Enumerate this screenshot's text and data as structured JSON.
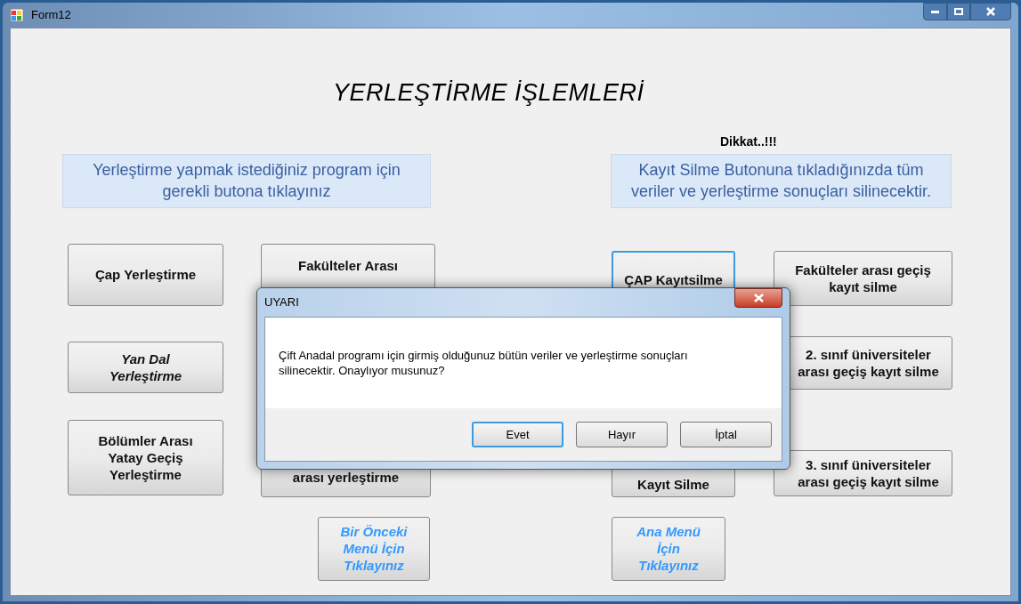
{
  "window": {
    "title": "Form12"
  },
  "heading": "YERLEŞTİRME İŞLEMLERİ",
  "left_note": "Yerleştirme yapmak istediğiniz program için gerekli butona tıklayınız",
  "warning_label": "Dikkat..!!!",
  "right_note": "Kayıt Silme Butonuna tıkladığınızda tüm veriler ve yerleştirme sonuçları silinecektir.",
  "columns": [
    {
      "buttons": [
        {
          "label": "Çap Yerleştirme",
          "kind": "bold",
          "focused": false
        },
        {
          "label": "Yan Dal\nYerleştirme",
          "kind": "italic",
          "focused": false
        },
        {
          "label": "Bölümler Arası\nYatay Geçiş\nYerleştirme",
          "kind": "bold",
          "focused": false
        }
      ]
    },
    {
      "buttons": [
        {
          "label": "Fakülteler Arası",
          "kind": "bold",
          "focused": false
        },
        {
          "label": "arası yerleştirme",
          "kind": "bold",
          "focused": false
        },
        {
          "label": "Bir Önceki\nMenü İçin\nTıklayınız",
          "kind": "link",
          "focused": false
        }
      ]
    },
    {
      "buttons": [
        {
          "label": "ÇAP Kayıtsilme",
          "kind": "bold",
          "focused": true
        },
        {
          "label": "Kayıt Silme",
          "kind": "bold",
          "focused": false
        },
        {
          "label": "Ana Menü\nİçin\nTıklayınız",
          "kind": "link",
          "focused": false
        }
      ]
    },
    {
      "buttons": [
        {
          "label": "Fakülteler arası geçiş\nkayıt silme",
          "kind": "bold",
          "focused": false
        },
        {
          "label": "2. sınıf üniversiteler\narası geçiş kayıt silme",
          "kind": "bold",
          "focused": false
        },
        {
          "label": "3. sınıf üniversiteler\narası geçiş kayıt silme",
          "kind": "bold",
          "focused": false
        }
      ]
    }
  ],
  "dialog": {
    "title": "UYARI",
    "message": "Çift Anadal programı için girmiş olduğunuz bütün veriler ve yerleştirme sonuçları silinecektir. Onaylıyor musunuz?",
    "buttons": [
      {
        "label": "Evet",
        "default": true
      },
      {
        "label": "Hayır",
        "default": false
      },
      {
        "label": "İptal",
        "default": false
      }
    ]
  }
}
